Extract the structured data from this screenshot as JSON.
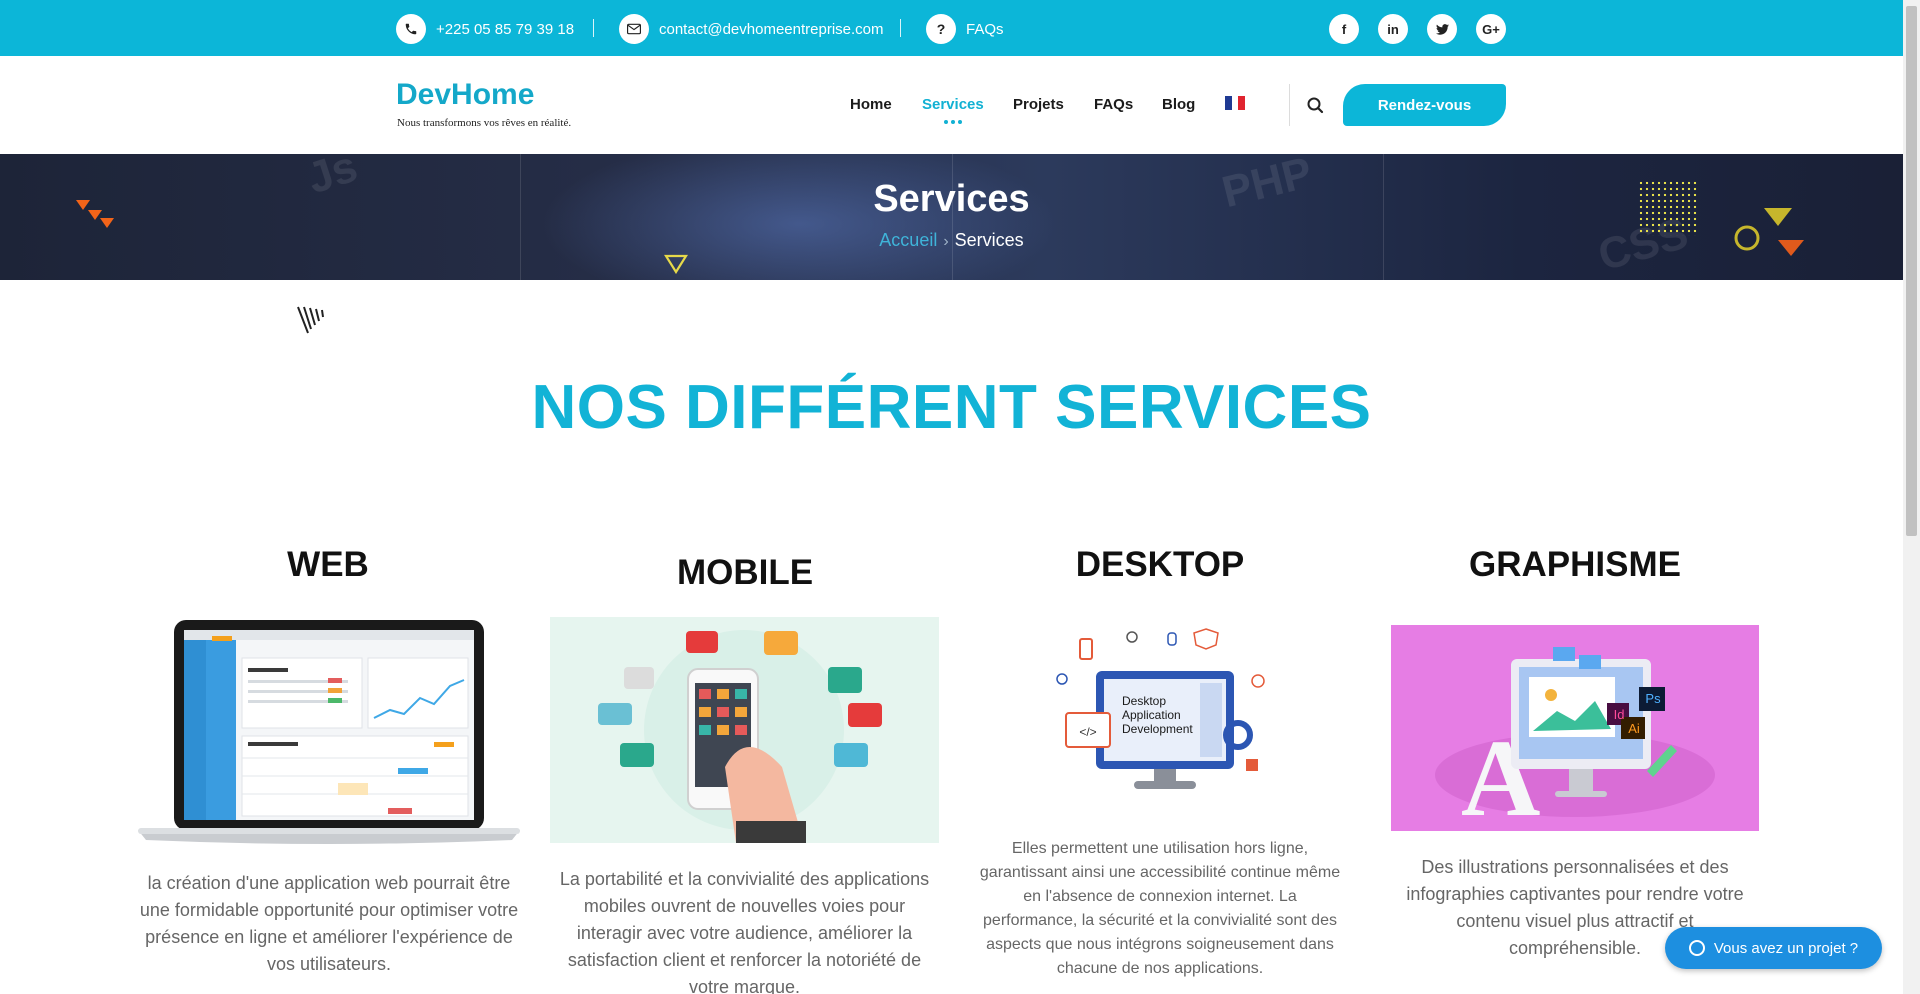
{
  "topbar": {
    "phone": "+225 05 85 79 39 18",
    "email": "contact@devhomeentreprise.com",
    "faq_link": "FAQs",
    "phone_icon": "phone-icon",
    "email_icon": "envelope-icon",
    "faq_icon": "question-icon",
    "social": [
      {
        "name": "facebook-icon",
        "glyph": "f"
      },
      {
        "name": "linkedin-icon",
        "glyph": "in"
      },
      {
        "name": "twitter-icon",
        "glyph": "t"
      },
      {
        "name": "google-plus-icon",
        "glyph": "G+"
      }
    ],
    "bg_color": "#0cb6d8"
  },
  "brand": {
    "title": "DevHome",
    "tagline": "Nous transformons vos rêves en réalité."
  },
  "nav": {
    "items": [
      "Home",
      "Services",
      "Projets",
      "FAQs",
      "Blog"
    ],
    "active": "Services",
    "language_icon": "france-flag-icon",
    "search_icon": "search-icon",
    "cta": "Rendez-vous",
    "accent": "#12b1d3"
  },
  "hero": {
    "title": "Services",
    "breadcrumb_home": "Accueil",
    "breadcrumb_sep": "›",
    "breadcrumb_current": "Services"
  },
  "main": {
    "section_title": "NOS DIFFÉRENT SERVICES",
    "services": [
      {
        "title": "WEB",
        "image_icon": "laptop-dashboard-illustration",
        "description": "la création d'une application web pourrait être une formidable opportunité pour optimiser votre présence en ligne et améliorer l'expérience de vos utilisateurs."
      },
      {
        "title": "MOBILE",
        "image_icon": "smartphone-apps-illustration",
        "description": "La portabilité et la convivialité des applications mobiles ouvrent de nouvelles voies pour interagir avec votre audience, améliorer la satisfaction client et renforcer la notoriété de votre marque."
      },
      {
        "title": "DESKTOP",
        "image_icon": "desktop-monitor-illustration",
        "image_caption": "Desktop Application Development",
        "description": "Elles permettent une utilisation hors ligne, garantissant ainsi une accessibilité continue même en l'absence de connexion internet. La performance, la sécurité et la convivialité sont des aspects que nous intégrons soigneusement dans chacune de nos applications."
      },
      {
        "title": "GRAPHISME",
        "image_icon": "graphic-design-illustration",
        "image_labels": [
          "Ps",
          "Id",
          "Ai"
        ],
        "description": "Des illustrations personnalisées et des infographies captivantes pour rendre votre contenu visuel plus attractif et compréhensible."
      }
    ]
  },
  "floating": {
    "label": "Vous avez un projet ?",
    "icon": "whatsapp-icon",
    "color": "#1d8fe0"
  }
}
